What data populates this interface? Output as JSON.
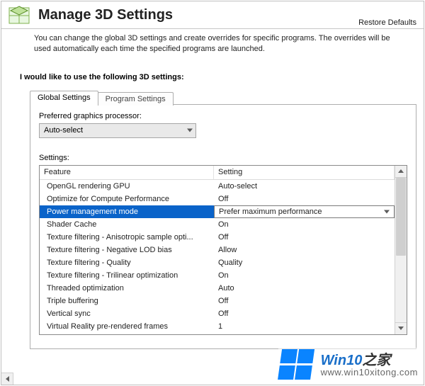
{
  "header": {
    "title": "Manage 3D Settings",
    "restore_link": "Restore Defaults"
  },
  "description": "You can change the global 3D settings and create overrides for specific programs. The overrides will be used automatically each time the specified programs are launched.",
  "section_heading": "I would like to use the following 3D settings:",
  "tabs": {
    "global": "Global Settings",
    "program": "Program Settings"
  },
  "pref_label": "Preferred graphics processor:",
  "pref_value": "Auto-select",
  "settings_label": "Settings:",
  "columns": {
    "feature": "Feature",
    "setting": "Setting"
  },
  "selected_index": 2,
  "rows": [
    {
      "feature": "OpenGL rendering GPU",
      "setting": "Auto-select"
    },
    {
      "feature": "Optimize for Compute Performance",
      "setting": "Off"
    },
    {
      "feature": "Power management mode",
      "setting": "Prefer maximum performance"
    },
    {
      "feature": "Shader Cache",
      "setting": "On"
    },
    {
      "feature": "Texture filtering - Anisotropic sample opti...",
      "setting": "Off"
    },
    {
      "feature": "Texture filtering - Negative LOD bias",
      "setting": "Allow"
    },
    {
      "feature": "Texture filtering - Quality",
      "setting": "Quality"
    },
    {
      "feature": "Texture filtering - Trilinear optimization",
      "setting": "On"
    },
    {
      "feature": "Threaded optimization",
      "setting": "Auto"
    },
    {
      "feature": "Triple buffering",
      "setting": "Off"
    },
    {
      "feature": "Vertical sync",
      "setting": "Off"
    },
    {
      "feature": "Virtual Reality pre-rendered frames",
      "setting": "1"
    }
  ],
  "watermark": {
    "brand_en": "Win10",
    "brand_cn": "之家",
    "url": "www.win10xitong.com"
  }
}
